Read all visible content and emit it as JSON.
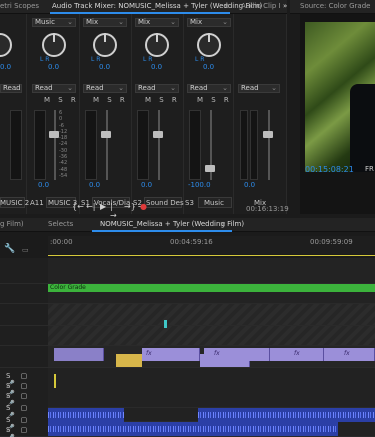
{
  "panels": {
    "top_left_tab": "etri Scopes",
    "mixer_tab": "Audio Track Mixer: NOMUSIC_Melissa + Tyler (Wedding Film)",
    "mixer_tab_menu": "≡",
    "clip_tab": "Audio Clip I",
    "overflow": "»",
    "source_tab": "Source: Color Grade"
  },
  "mixer": {
    "channels": [
      {
        "input": "",
        "pan": "0.0",
        "mode": "Read",
        "db": "",
        "label": "A10",
        "name": "MUSIC 2"
      },
      {
        "input": "Music",
        "pan": "0.0",
        "mode": "Read",
        "db": "0.0",
        "label": "A11",
        "name": "MUSIC 3"
      },
      {
        "input": "Mix",
        "pan": "0.0",
        "mode": "Read",
        "db": "0.0",
        "label": "S1",
        "name": "Vocals/Dia"
      },
      {
        "input": "Mix",
        "pan": "0.0",
        "mode": "Read",
        "db": "0.0",
        "label": "S2",
        "name": "Sound Des"
      },
      {
        "input": "Mix",
        "pan": "0.0",
        "mode": "Read",
        "db": "-100.0",
        "label": "S3",
        "name": "Music"
      }
    ],
    "mix": {
      "input": "",
      "mode": "Read",
      "db": "0.0",
      "name": "Mix"
    },
    "msr": "M S R",
    "knob_lr": "L   R",
    "scale_top": "dB",
    "scale_marks": [
      "6",
      "0",
      "-6",
      "-12",
      "-18",
      "-24",
      "-30",
      "-36",
      "-42",
      "-48",
      "-54",
      "dB"
    ],
    "timecode": "00:16:13:19"
  },
  "transport": {
    "buttons": [
      "{←",
      "←|",
      "▶",
      "|→",
      "→}",
      "⇥",
      "●"
    ]
  },
  "monitor": {
    "timecode": "00:15:08:21",
    "fit": "FR"
  },
  "timeline": {
    "left_tab": "g Film)",
    "selects_tab": "Selects",
    "sequence_tab": "NOMUSIC_Melissa + Tyler (Wedding Film)",
    "menu": "≡",
    "ruler": [
      ":00:00",
      "00:04:59:16",
      "00:09:59:09"
    ],
    "adjustment_clip": "Color Grade",
    "track_controls": "S ▢ 🎤"
  },
  "colors": {
    "accent": "#2d8ceb",
    "adjustment": "#3cb33c",
    "video_clip": "#9b8fd9",
    "audio_clip": "#2b3fa6",
    "playhead": "#d6c93a",
    "record": "#e03b3b"
  }
}
